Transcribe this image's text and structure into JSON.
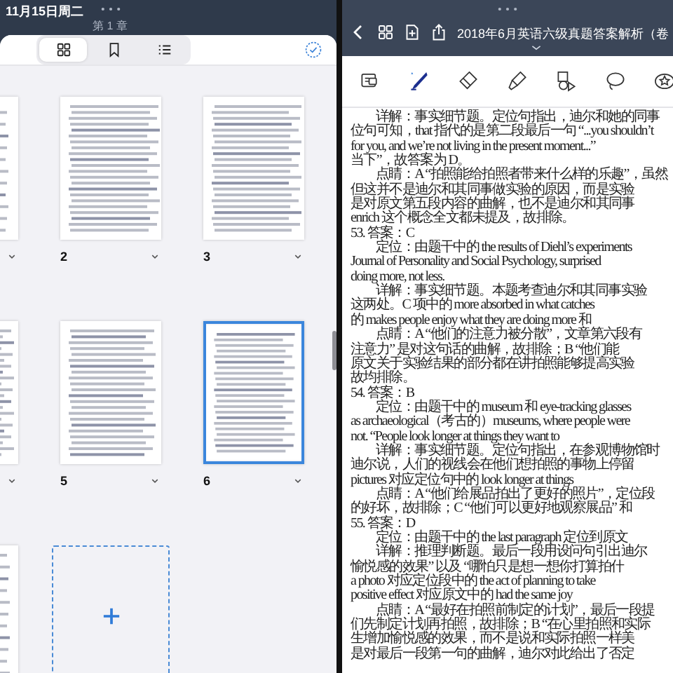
{
  "status_bar": {
    "time": "11月15日周二"
  },
  "left_pane": {
    "chapter": "第 1 章",
    "view_tabs": [
      {
        "kind": "grid",
        "selected": true
      },
      {
        "kind": "bookmark",
        "selected": false
      },
      {
        "kind": "list",
        "selected": false
      }
    ],
    "pages": [
      {
        "kind": "page",
        "selected": false
      },
      {
        "kind": "page",
        "number": "2",
        "selected": false
      },
      {
        "kind": "page",
        "number": "3",
        "selected": false
      },
      {
        "kind": "page",
        "selected": false
      },
      {
        "kind": "page",
        "number": "5",
        "selected": false
      },
      {
        "kind": "page",
        "number": "6",
        "selected": true
      },
      {
        "kind": "page",
        "selected": false
      },
      {
        "kind": "add",
        "selected": false
      }
    ]
  },
  "reader": {
    "title": "2018年6月英语六级真题答案解析（卷",
    "tools": [
      {
        "kind": "reader"
      },
      {
        "kind": "pen"
      },
      {
        "kind": "eraser"
      },
      {
        "kind": "highlighter"
      },
      {
        "kind": "shapes"
      },
      {
        "kind": "lasso"
      },
      {
        "kind": "sticker"
      }
    ],
    "lines": [
      {
        "text": "详解：事实细节题。定位句指出，迪尔和她的同事",
        "indent": true
      },
      {
        "text": "位句可知，that 指代的是第二段最后一句 “...you shouldn’t",
        "indent": false
      },
      {
        "text": "for you, and we’re not living in the present moment...”",
        "indent": false
      },
      {
        "text": "当下”，故答案为 D。",
        "indent": false
      },
      {
        "text": "点睛：A “拍照能给拍照者带来什么样的乐趣”，虽然",
        "indent": true
      },
      {
        "text": "但这并不是迪尔和其同事做实验的原因，而是实验",
        "indent": false
      },
      {
        "text": "是对原文第五段内容的曲解，也不是迪尔和其同事",
        "indent": false
      },
      {
        "text": "enrich 这个概念全文都未提及，故排除。",
        "indent": false
      },
      {
        "text": "53. 答案：C",
        "indent": false
      },
      {
        "text": "定位：由题干中的 the results of Diehl’s experiments",
        "indent": true
      },
      {
        "text": "Journal of Personality and Social Psychology, surprised",
        "indent": false
      },
      {
        "text": "doing more, not less.",
        "indent": false
      },
      {
        "text": "详解：事实细节题。本题考查迪尔和其同事实验",
        "indent": true
      },
      {
        "text": "这两处。C 项中的 more absorbed in what catches",
        "indent": false
      },
      {
        "text": "的 makes people enjoy what they are doing more 和",
        "indent": false
      },
      {
        "text": "点睛：A “他们的注意力被分散”，文章第六段有",
        "indent": true
      },
      {
        "text": "注意力” 是对这句话的曲解，故排除；B “他们能",
        "indent": false
      },
      {
        "text": "原文关于实验结果的部分都在讲拍照能够提高实验",
        "indent": false
      },
      {
        "text": "故均排除。",
        "indent": false
      },
      {
        "text": "54. 答案：B",
        "indent": false
      },
      {
        "text": "定位：由题干中的 museum 和 eye-tracking glasses",
        "indent": true
      },
      {
        "text": "as archaeological（考古的）museums, where people were",
        "indent": false
      },
      {
        "text": "not. “People look longer at things they want to",
        "indent": false
      },
      {
        "text": "详解：事实细节题。定位句指出，在参观博物馆时",
        "indent": true
      },
      {
        "text": "迪尔说，人们的视线会在他们想拍照的事物上停留",
        "indent": false
      },
      {
        "text": "pictures 对应定位句中的 look longer at things",
        "indent": false
      },
      {
        "text": "点睛：A “他们给展品拍出了更好的照片”，定位段",
        "indent": true
      },
      {
        "text": "的好坏，故排除；C “他们可以更好地观察展品” 和",
        "indent": false
      },
      {
        "text": "55. 答案：D",
        "indent": false
      },
      {
        "text": "定位：由题干中的 the last paragraph 定位到原文",
        "indent": true
      },
      {
        "text": "详解：推理判断题。最后一段用设问句引出迪尔",
        "indent": true
      },
      {
        "text": "愉悦感的效果” 以及 “哪怕只是想一想你打算拍什",
        "indent": false
      },
      {
        "text": "a photo 对应定位段中的 the act of planning to take",
        "indent": false
      },
      {
        "text": "positive effect 对应原文中的 had the same joy",
        "indent": false
      },
      {
        "text": "点睛：A “最好在拍照前制定的计划”，最后一段提",
        "indent": true
      },
      {
        "text": "们先制定计划再拍照，故排除；B “在心里拍照和实际",
        "indent": false
      },
      {
        "text": "生增加愉悦感的效果，而不是说和实际拍照一样美",
        "indent": false
      },
      {
        "text": "是对最后一段第一句的曲解，迪尔对此给出了否定",
        "indent": false
      }
    ]
  }
}
